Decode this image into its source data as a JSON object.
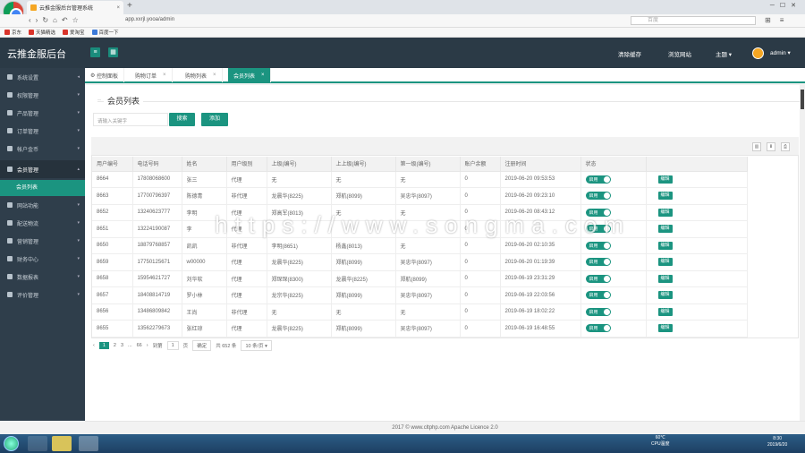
{
  "browser": {
    "tab_title": "云推金服后台管理系统",
    "url": "app.xxrjl.yooa/admin",
    "search_placeholder": "百度",
    "bookmarks": [
      "京东",
      "天猫精选",
      "爱淘宝",
      "百度一下"
    ]
  },
  "header": {
    "logo": "云推金服后台",
    "links": [
      "清除缓存",
      "浏览网站",
      "主题"
    ],
    "user": "admin"
  },
  "sidebar": {
    "items": [
      "系统设置",
      "权限管理",
      "产品管理",
      "订单管理",
      "帐户金币",
      "会员管理",
      "网站功能",
      "配送物流",
      "营销管理",
      "财务中心",
      "数据报表",
      "评价管理"
    ],
    "active_sub": "会员列表"
  },
  "content_tabs": [
    "控制面板",
    "购物订单",
    "购物列表",
    "会员列表"
  ],
  "page": {
    "title": "会员列表",
    "search_placeholder": "请输入关键字",
    "search_btn": "搜索",
    "add_btn": "添加"
  },
  "table": {
    "headers": [
      "用户编号",
      "电话号码",
      "姓名",
      "用户级别",
      "上级(编号)",
      "上上级(编号)",
      "第一级(编号)",
      "账户余额",
      "注册时间",
      "状态",
      ""
    ],
    "rows": [
      [
        "8664",
        "17808068600",
        "张三",
        "代理",
        "无",
        "无",
        "无",
        "0",
        "2019-06-20 09:53:53"
      ],
      [
        "8663",
        "17700796397",
        "陈德青",
        "非代理",
        "龙晨华(8225)",
        "郑航(8099)",
        "吴忠华(8097)",
        "0",
        "2019-06-20 09:23:10"
      ],
      [
        "8652",
        "13240623777",
        "李明",
        "代理",
        "郑高军(8013)",
        "无",
        "无",
        "0",
        "2019-06-20 08:43:12"
      ],
      [
        "8651",
        "13224190087",
        "李",
        "代理",
        "",
        "",
        "",
        "0",
        ""
      ],
      [
        "8650",
        "18879768857",
        "凯凯",
        "非代理",
        "李明(8651)",
        "杨鑫(8013)",
        "无",
        "0",
        "2019-06-20 02:10:35"
      ],
      [
        "8659",
        "17750125671",
        "w00000",
        "代理",
        "龙晨华(8225)",
        "郑航(8099)",
        "吴忠华(8097)",
        "0",
        "2019-06-20 01:19:39"
      ],
      [
        "8658",
        "15954621727",
        "刘华软",
        "代理",
        "郑琛琛(8300)",
        "龙晨华(8225)",
        "郑航(8099)",
        "0",
        "2019-06-19 23:31:29"
      ],
      [
        "8657",
        "18408814719",
        "罗小林",
        "代理",
        "龙宗华(8225)",
        "郑航(8099)",
        "吴忠华(8097)",
        "0",
        "2019-06-19 22:03:56"
      ],
      [
        "8656",
        "13486809842",
        "王尚",
        "非代理",
        "无",
        "无",
        "无",
        "0",
        "2019-06-19 18:02:22"
      ],
      [
        "8655",
        "13562279673",
        "张红琼",
        "代理",
        "龙晨华(8225)",
        "郑航(8099)",
        "吴忠华(8097)",
        "0",
        "2019-06-19 16:48:55"
      ]
    ],
    "status_label": "启用",
    "edit_label": "编辑"
  },
  "pager": {
    "pages": [
      "1",
      "2",
      "3",
      "...",
      "66"
    ],
    "goto_label": "到第",
    "goto_value": "1",
    "page_unit": "页",
    "confirm": "确定",
    "total": "共 652 条",
    "per_page": "10 条/页"
  },
  "footer": "2017 © www.cltphp.com Apache Licence 2.0",
  "watermark": "https://www.songma.com",
  "taskbar": {
    "temp": "60℃",
    "cpu": "CPU温度",
    "time": "8:30",
    "date": "2019/6/20"
  }
}
